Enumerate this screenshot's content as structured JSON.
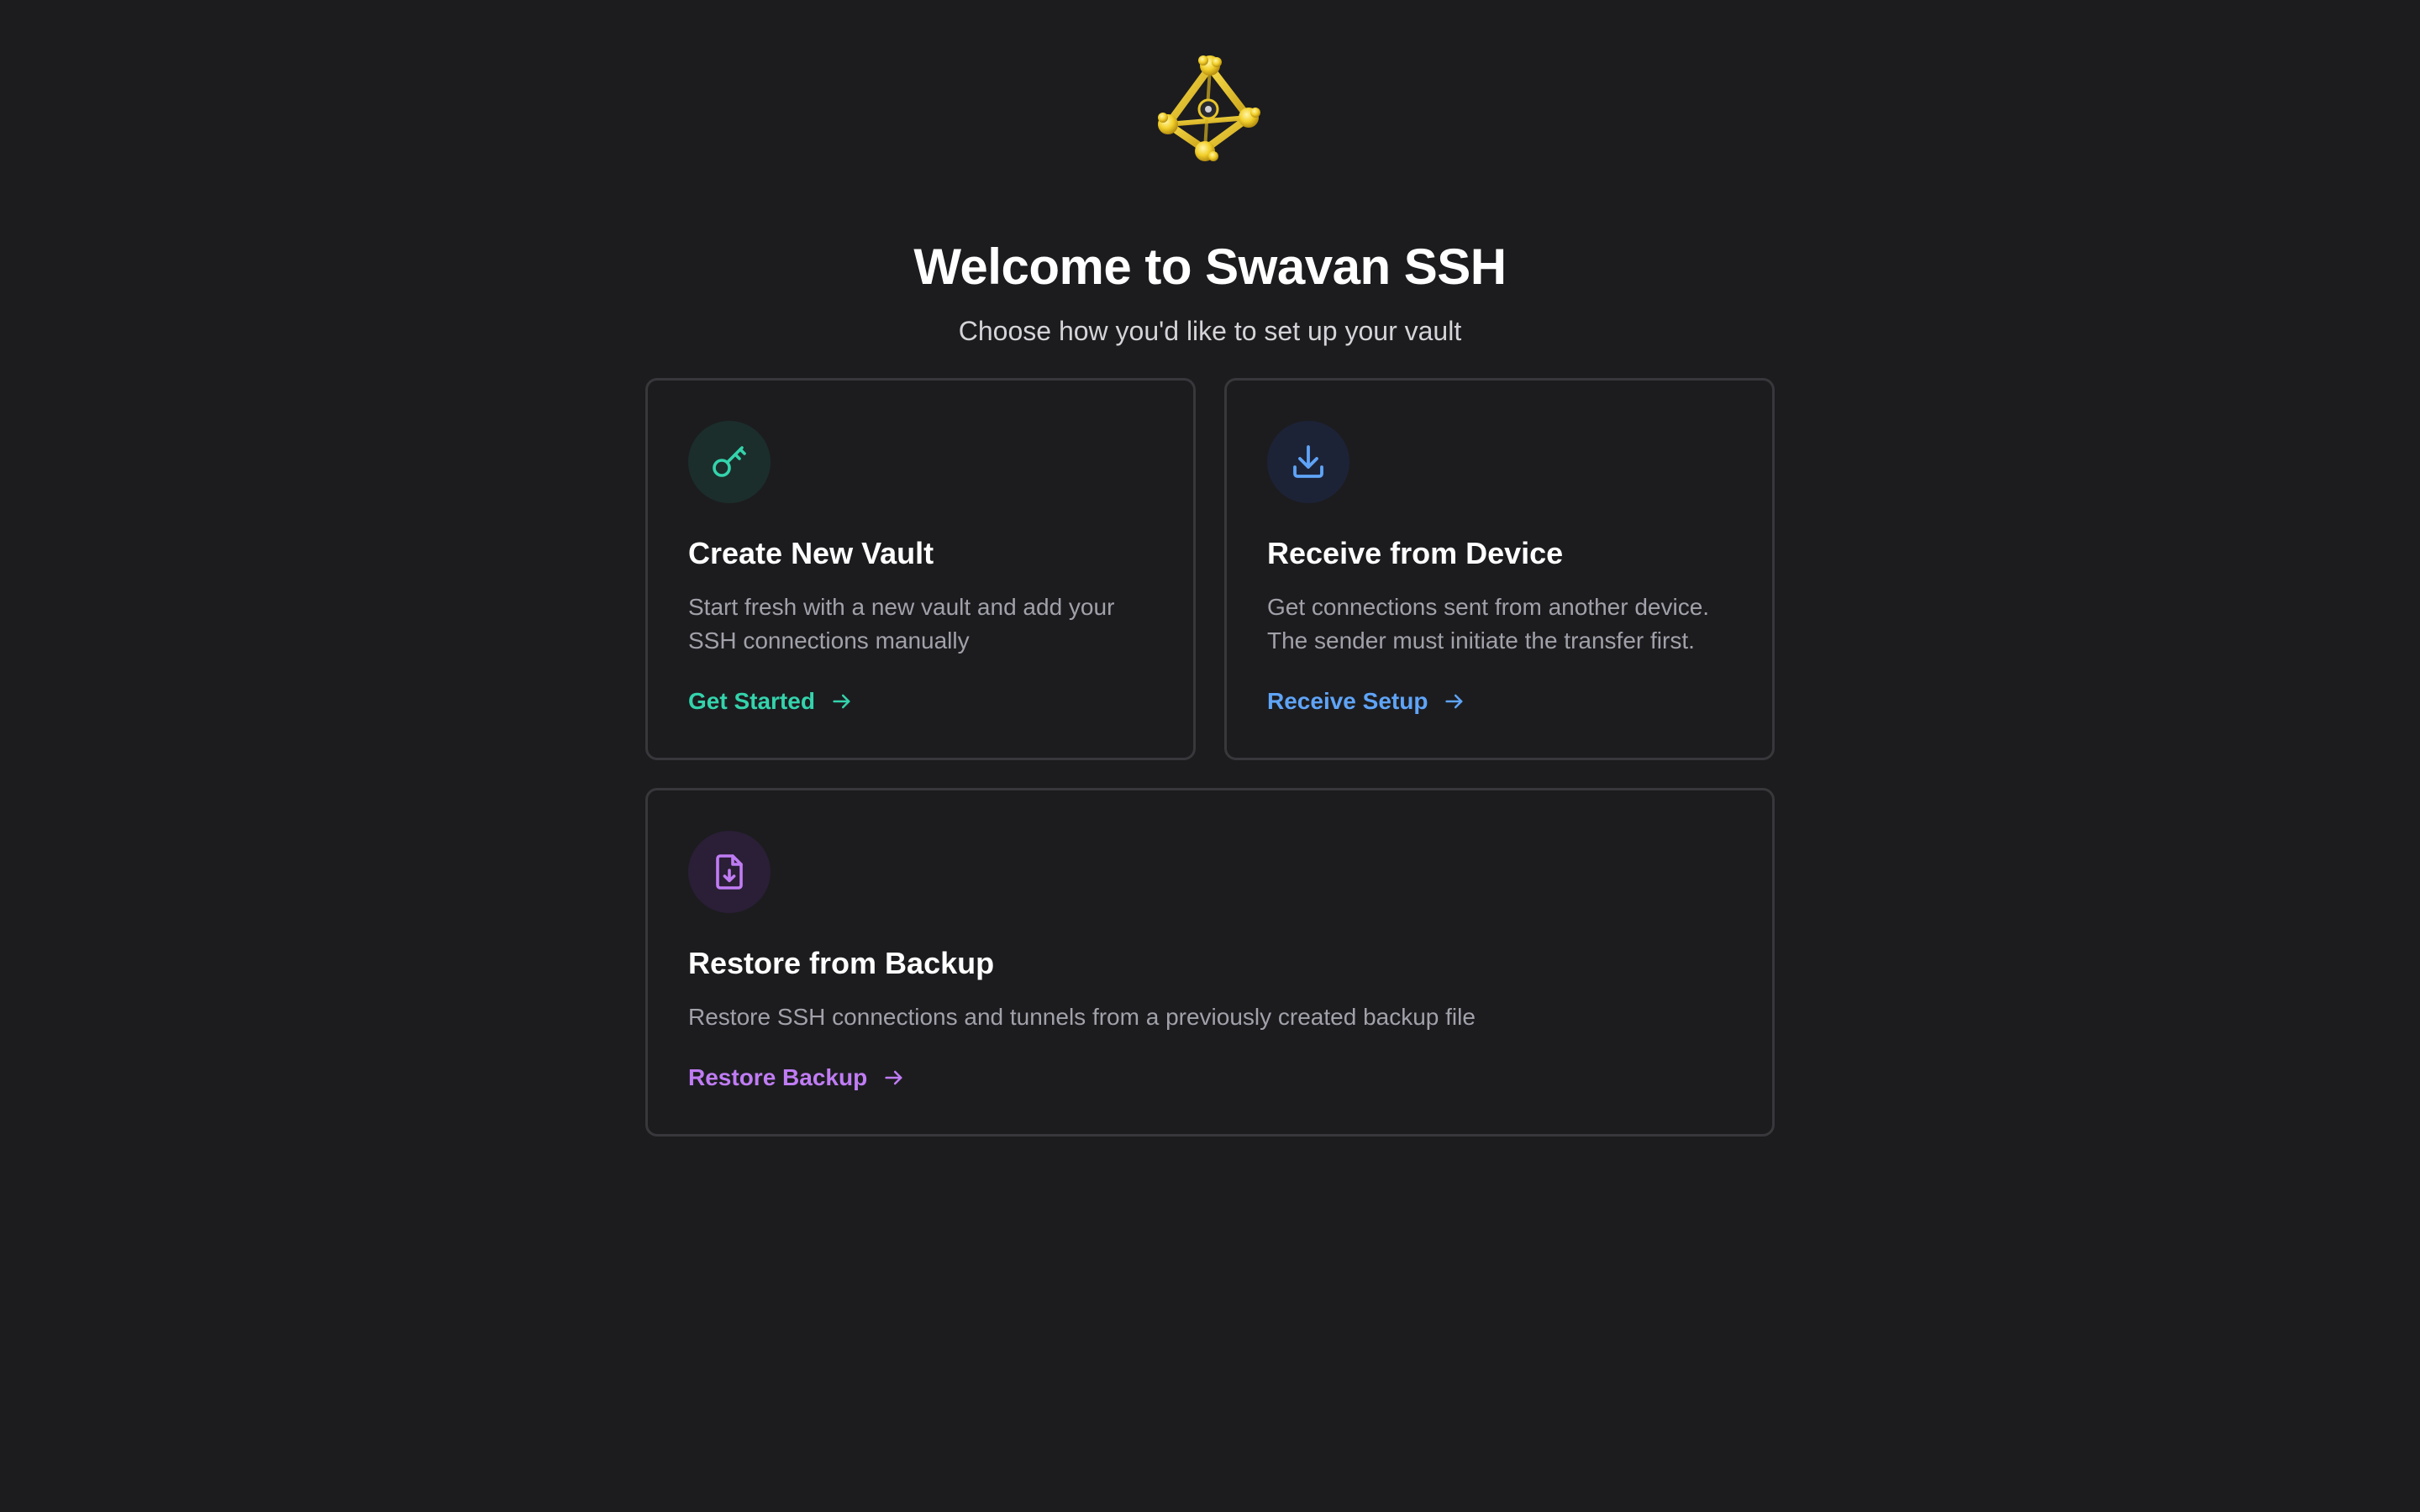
{
  "header": {
    "title": "Welcome to Swavan SSH",
    "subtitle": "Choose how you'd like to set up your vault",
    "logo_icon": "swavan-logo-icon"
  },
  "cards": [
    {
      "title": "Create New Vault",
      "description": "Start fresh with a new vault and add your SSH connections manually",
      "link_label": "Get Started",
      "icon": "key-icon",
      "accent": "#34d3ac"
    },
    {
      "title": "Receive from Device",
      "description": "Get connections sent from another device. The sender must initiate the transfer first.",
      "link_label": "Receive Setup",
      "icon": "download-icon",
      "accent": "#5fa4f7"
    },
    {
      "title": "Restore from Backup",
      "description": "Restore SSH connections and tunnels from a previously created backup file",
      "link_label": "Restore Backup",
      "icon": "file-download-icon",
      "accent": "#c07cf4"
    }
  ],
  "colors": {
    "background": "#1c1c1f",
    "card_border": "#38383c",
    "text_primary": "#ffffff",
    "text_secondary": "#a1a1aa"
  }
}
